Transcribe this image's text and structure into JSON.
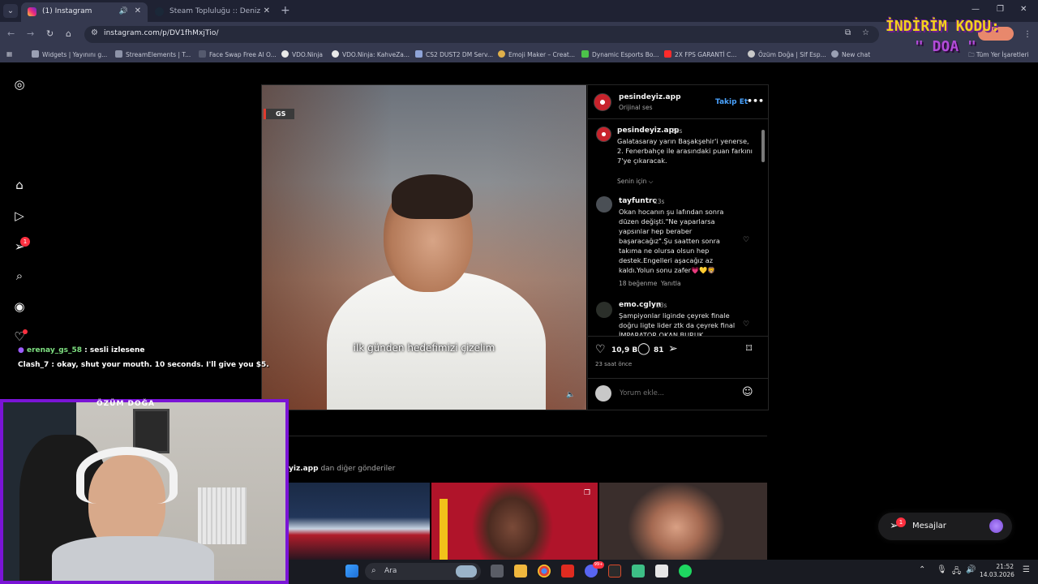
{
  "browser": {
    "tabs": [
      {
        "title": "(1) Instagram",
        "active": true
      },
      {
        "title": "Steam Topluluğu :: Deniz Tony",
        "active": false
      }
    ],
    "url": "instagram.com/p/DV1fhMxjTio/",
    "bookmarks": [
      "Widgets | Yayınını g...",
      "StreamElements | T...",
      "Face Swap Free AI O...",
      "VDO.Ninja",
      "VDO.Ninja: KahveZa...",
      "CS2 DUST2 DM Serv...",
      "Emoji Maker – Creat...",
      "Dynamic Esports Bo...",
      "2X FPS GARANTİ C...",
      "Özüm Doğa | Slf Esp...",
      "New chat"
    ],
    "all_bookmarks": "Tüm Yer İşaretleri"
  },
  "promo": {
    "line1": "İNDİRİM KODU:",
    "line2": "\" DOA \""
  },
  "post": {
    "author": "pesindeyiz.app",
    "audio": "Orijinal ses",
    "follow": "Takip Et",
    "more": "•••",
    "badge": "GS",
    "subtitle": "ilk günden hedefimizi çizelim",
    "caption": {
      "user": "pesindeyiz.app",
      "time": "23s",
      "text": "Galatasaray yarın Başakşehir'i yenerse, 2. Fenerbahçe ile arasındaki puan farkını 7'ye çıkaracak."
    },
    "for_you": "Senin için ⌵",
    "comments": [
      {
        "user": "tayfuntrc",
        "time": "23s",
        "text": "Okan hocanın şu lafından sonra düzen değişti.\"Ne yaparlarsa yapsınlar hep beraber başaracağız\".Şu saatten sonra takıma ne olursa olsun hep destek.Engelleri aşacağız az kaldı.Yolun sonu zafer💗💛🦁",
        "likes": "18 beğenme",
        "reply": "Yanıtla"
      },
      {
        "user": "emo.cglyn",
        "time": "23s",
        "text": "Şampiyonlar liginde çeyrek finale doğru ligte lider ztk da çeyrek final İMPARATOR OKAN BURUK"
      }
    ],
    "likes_count": "10,9 B",
    "comments_count": "81",
    "posted_ago": "23 saat önce",
    "comment_placeholder": "Yorum ekle...",
    "more_posts_prefix": "yiz.app",
    "more_posts_suffix": " dan diğer gönderiler"
  },
  "rail": {
    "notifications_badge": "1"
  },
  "chat": [
    {
      "user": "erenay_gs_58",
      "text": " : sesli izlesene"
    },
    {
      "user": "Clash_7",
      "text": " : okay, shut your mouth. 10 seconds. I'll give you $5."
    }
  ],
  "webcam": {
    "label": "ÖZÜM DOĞA"
  },
  "messages": {
    "label": "Mesajlar",
    "badge": "1"
  },
  "taskbar": {
    "search": "Ara",
    "time": "21:52",
    "date": "14.03.2026",
    "badge": "99+"
  },
  "colors": {
    "accent_blue": "#4aa3ff",
    "cam_border": "#7a14d6",
    "promo_yellow": "#f2d21b",
    "badge_red": "#ff3040"
  }
}
